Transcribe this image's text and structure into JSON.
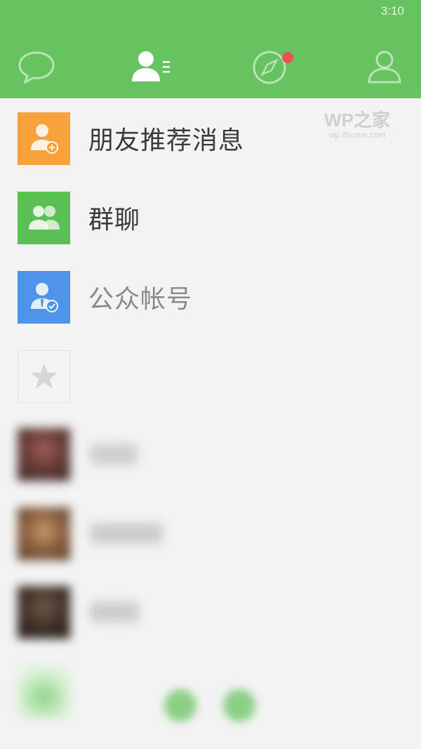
{
  "status_bar": {
    "time": "3:10"
  },
  "tabs": [
    {
      "name": "chats",
      "icon": "chat-bubble-icon",
      "active": false
    },
    {
      "name": "contacts",
      "icon": "contacts-icon",
      "active": true
    },
    {
      "name": "discover",
      "icon": "compass-icon",
      "active": false,
      "badge": true
    },
    {
      "name": "me",
      "icon": "person-icon",
      "active": false
    }
  ],
  "watermark": {
    "brand": "WP之家",
    "site": "wp.ithome.com"
  },
  "contacts": {
    "items": [
      {
        "label": "朋友推荐消息",
        "icon": "add-friend-icon",
        "color": "#f9a13a"
      },
      {
        "label": "群聊",
        "icon": "group-chat-icon",
        "color": "#5bbf55"
      },
      {
        "label": "公众帐号",
        "icon": "official-account-icon",
        "color": "#4f94e8"
      },
      {
        "label": "",
        "icon": "star-icon",
        "color": "#f4f4f4"
      }
    ]
  },
  "colors": {
    "header_green": "#67c35f",
    "badge_red": "#e5545a",
    "background": "#f3f3f3"
  }
}
